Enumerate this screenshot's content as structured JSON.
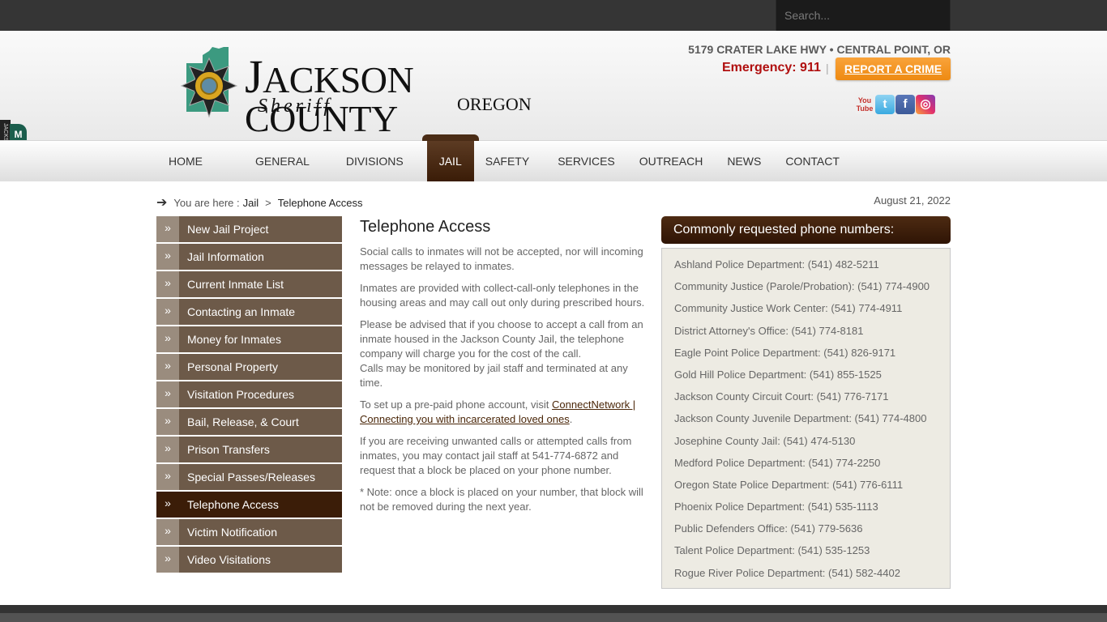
{
  "search": {
    "placeholder": "Search..."
  },
  "header": {
    "logo": {
      "title_first": "J",
      "title_rest": "ACKSON COUNTY",
      "subtitle": "Sheriff",
      "state": "OREGON"
    },
    "address": "5179 CRATER LAKE HWY • CENTRAL POINT, OR",
    "emergency": "Emergency: 911",
    "separator": "|",
    "report_label": "REPORT A CRIME",
    "social": [
      {
        "name": "youtube-icon",
        "glyph": "You Tube"
      },
      {
        "name": "twitter-icon",
        "glyph": "t"
      },
      {
        "name": "facebook-icon",
        "glyph": "f"
      },
      {
        "name": "instagram-icon",
        "glyph": "◎"
      }
    ]
  },
  "menu_tab": {
    "side_label": "JACKSON COUNTY",
    "label": "M E N U"
  },
  "nav": {
    "items": [
      "HOME",
      "GENERAL",
      "DIVISIONS",
      "JAIL",
      "SAFETY",
      "SERVICES",
      "OUTREACH",
      "NEWS",
      "CONTACT"
    ],
    "active": "JAIL"
  },
  "breadcrumb": {
    "arrow": "➔",
    "prefix": "You are here :",
    "items": [
      "Jail",
      ">",
      "Telephone Access"
    ]
  },
  "date": "August 21, 2022",
  "sidebar": {
    "chevron": "»",
    "items": [
      "New Jail Project",
      "Jail Information",
      "Current Inmate List",
      "Contacting an Inmate",
      "Money for Inmates",
      "Personal Property",
      "Visitation Procedures",
      "Bail, Release, & Court",
      "Prison Transfers",
      "Special Passes/Releases",
      "Telephone Access",
      "Victim Notification",
      "Video Visitations"
    ],
    "active_index": 10
  },
  "content": {
    "title": "Telephone Access",
    "p1": "Social calls to inmates will not be accepted, nor will incoming messages be relayed to inmates.",
    "p2": "Inmates are provided with collect-call-only telephones in the housing areas and may call out only during prescribed hours.",
    "p3a": "Please be advised that if you choose to accept a call from an inmate housed in the Jackson County Jail, the telephone company will charge you for the cost of the call.",
    "p3b": "Calls may be monitored by jail staff and terminated at any time.",
    "p4_prefix": "To set up a pre-paid phone account, visit ",
    "p4_link": "ConnectNetwork | Connecting you with incarcerated loved ones",
    "p4_suffix": ".",
    "p5": "If you are receiving unwanted calls or attempted calls from inmates, you may contact jail staff at 541-774-6872 and request that a block be placed on your phone number.",
    "p6": "* Note: once a block is placed on your number, that block will not be removed during the next year."
  },
  "phones": {
    "title": "Commonly requested phone numbers:",
    "items": [
      "Ashland Police Department: (541) 482-5211",
      "Community Justice (Parole/Probation): (541) 774-4900",
      "Community Justice Work Center: (541) 774-4911",
      "District Attorney's Office: (541) 774-8181",
      "Eagle Point Police Department: (541) 826-9171",
      "Gold Hill Police Department: (541) 855-1525",
      "Jackson County Circuit Court: (541) 776-7171",
      "Jackson County Juvenile Department: (541) 774-4800",
      "Josephine County Jail: (541) 474-5130",
      "Medford Police Department: (541) 774-2250",
      "Oregon State Police Department: (541) 776-6111",
      "Phoenix Police Department: (541) 535-1113",
      "Public Defenders Office: (541) 779-5636",
      "Talent Police Department: (541) 535-1253",
      "Rogue River Police Department: (541) 582-4402"
    ]
  },
  "colors": {
    "brand_brown": "#3b1d08",
    "sidebar_brown": "#6d5a49",
    "report_orange": "#f39a25",
    "emergency_red": "#b00f0f",
    "menu_green": "#1b5e4d"
  }
}
